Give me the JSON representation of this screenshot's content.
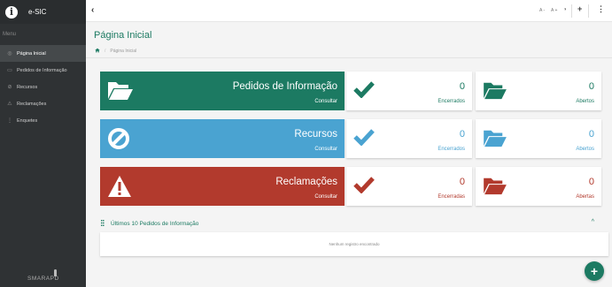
{
  "app": {
    "logo_letter": "i",
    "name": "e-SIC",
    "brand": "SMARAPD"
  },
  "sidebar": {
    "menu_label": "Menu",
    "items": [
      {
        "label": "Página Inicial",
        "icon": "gauge-icon",
        "glyph": "◎",
        "active": true
      },
      {
        "label": "Pedidos de Informação",
        "icon": "folder-icon",
        "glyph": "▭"
      },
      {
        "label": "Recursos",
        "icon": "ban-icon",
        "glyph": "⊘"
      },
      {
        "label": "Reclamações",
        "icon": "warning-icon",
        "glyph": "⚠"
      },
      {
        "label": "Enquetes",
        "icon": "vertical-dots-icon",
        "glyph": "⋮"
      }
    ]
  },
  "topbar": {
    "back": "‹",
    "font_decrease": "A -",
    "font_increase": "A +",
    "contrast": "◑",
    "add": "+",
    "more": "⋮"
  },
  "page": {
    "title": "Página Inicial",
    "breadcrumb_home_icon": "home-icon",
    "breadcrumb": "Página Inicial"
  },
  "tiles": [
    {
      "title": "Pedidos de Informação",
      "action": "Consultar",
      "closed_value": "0",
      "closed_label": "Encerrados",
      "open_value": "0",
      "open_label": "Abertos",
      "color": "#1c7a62"
    },
    {
      "title": "Recursos",
      "action": "Consultar",
      "closed_value": "0",
      "closed_label": "Encerrados",
      "open_value": "0",
      "open_label": "Abertos",
      "color": "#4aa3d1"
    },
    {
      "title": "Reclamações",
      "action": "Consultar",
      "closed_value": "0",
      "closed_label": "Encerradas",
      "open_value": "0",
      "open_label": "Abertas",
      "color": "#b23a2d"
    }
  ],
  "panel": {
    "title": "Últimos 10 Pedidos de Informação",
    "empty_text": "Nenhum registro encontrado",
    "chevron": "^"
  },
  "fab": {
    "label": "+"
  }
}
